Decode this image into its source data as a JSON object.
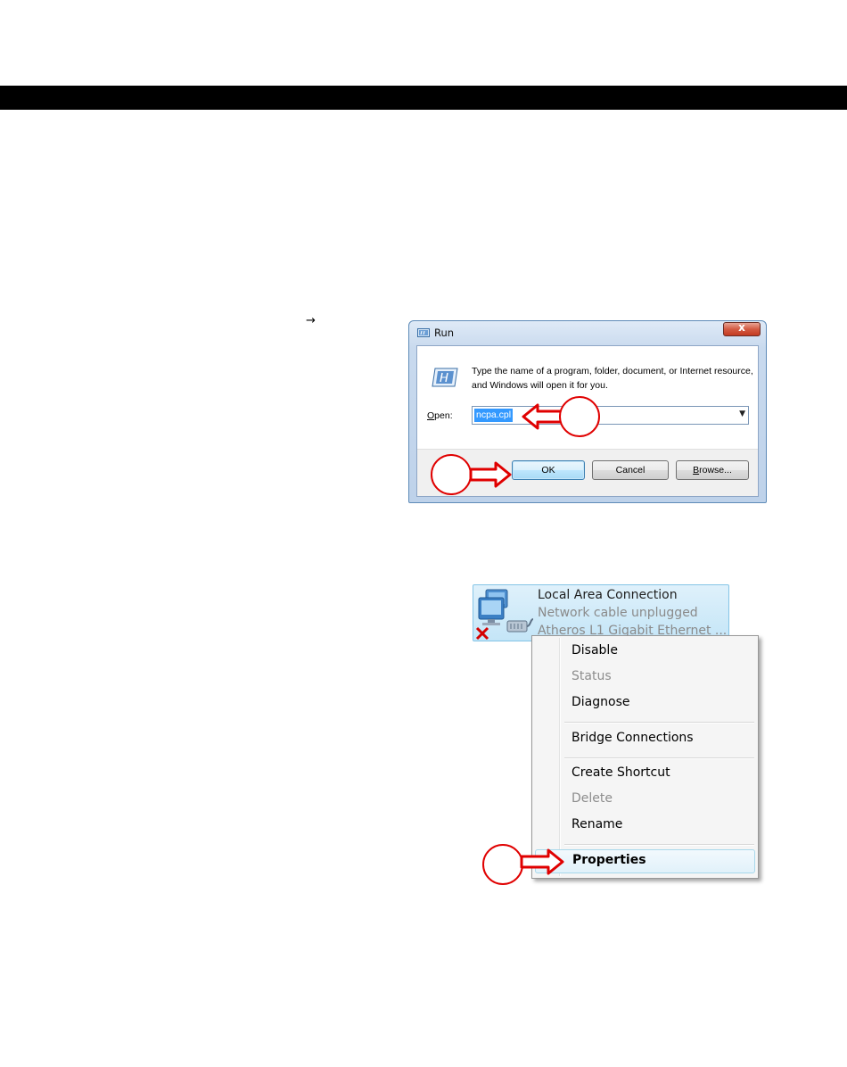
{
  "page": {
    "arrow_glyph": "→"
  },
  "run_dialog": {
    "title": "Run",
    "description": "Type the name of a program, folder, document, or Internet resource, and Windows will open it for you.",
    "open_label_accel": "O",
    "open_label_rest": "pen:",
    "open_value": "ncpa.cpl",
    "close_glyph": "x",
    "buttons": {
      "ok": "OK",
      "cancel": "Cancel",
      "browse_accel": "B",
      "browse_rest": "rowse..."
    }
  },
  "connection": {
    "name": "Local Area Connection",
    "status": "Network cable unplugged",
    "device": "Atheros L1 Gigabit Ethernet ..."
  },
  "context_menu": {
    "items": [
      {
        "label": "Disable",
        "disabled": false
      },
      {
        "label": "Status",
        "disabled": true
      },
      {
        "label": "Diagnose",
        "disabled": false
      },
      {
        "label": "Bridge Connections",
        "disabled": false
      },
      {
        "label": "Create Shortcut",
        "disabled": false
      },
      {
        "label": "Delete",
        "disabled": true
      },
      {
        "label": "Rename",
        "disabled": false
      },
      {
        "label": "Properties",
        "disabled": false,
        "default": true,
        "highlighted": true
      }
    ]
  },
  "colors": {
    "callout": "#e00000",
    "selection": "#3399ff",
    "black_bar": "#000000"
  }
}
